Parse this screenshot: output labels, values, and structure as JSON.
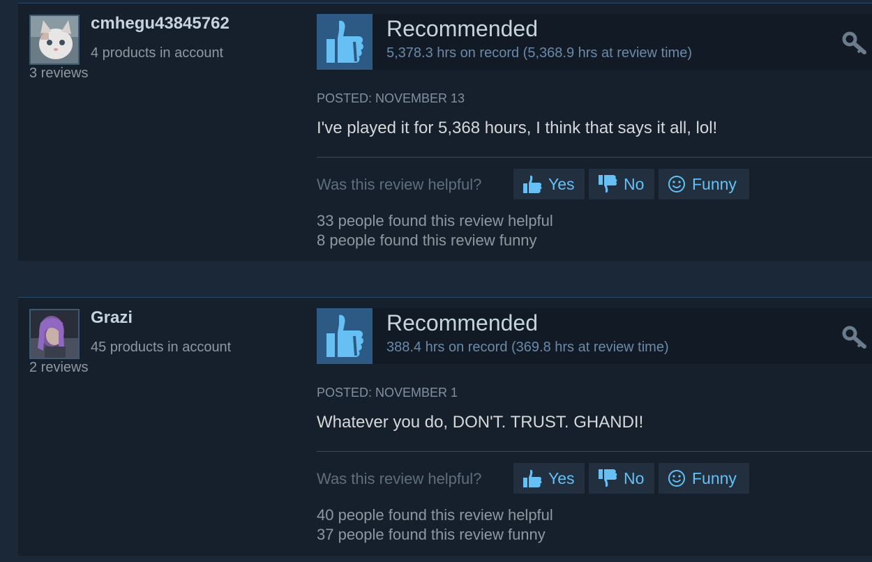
{
  "reviews": [
    {
      "username": "cmhegu43845762",
      "products": "4 products in account",
      "review_count": "3 reviews",
      "verdict": "Recommended",
      "hours": "5,378.3 hrs on record (5,368.9 hrs at review time)",
      "posted": "POSTED: NOVEMBER 13",
      "content": "I've played it for 5,368 hours, I think that says it all, lol!",
      "helpful_question": "Was this review helpful?",
      "yes_label": "Yes",
      "no_label": "No",
      "funny_label": "Funny",
      "helpful_count": "33 people found this review helpful",
      "funny_count": "8 people found this review funny"
    },
    {
      "username": "Grazi",
      "products": "45 products in account",
      "review_count": "2 reviews",
      "verdict": "Recommended",
      "hours": "388.4 hrs on record (369.8 hrs at review time)",
      "posted": "POSTED: NOVEMBER 1",
      "content": "Whatever you do, DON'T. TRUST. GHANDI!",
      "helpful_question": "Was this review helpful?",
      "yes_label": "Yes",
      "no_label": "No",
      "funny_label": "Funny",
      "helpful_count": "40 people found this review helpful",
      "funny_count": "37 people found this review funny"
    }
  ],
  "colors": {
    "page_bg": "#1b2838",
    "card_bg": "#16202d",
    "thumb_box": "#2c5a84",
    "thumb_icon": "#66c0f4",
    "link_blue": "#66c0f4",
    "button_bg": "#212f3e"
  },
  "icons": {
    "verdict": "thumbs-up-icon",
    "key": "key-icon",
    "yes": "thumbs-up-small-icon",
    "no": "thumbs-down-small-icon",
    "funny": "smiley-icon"
  }
}
